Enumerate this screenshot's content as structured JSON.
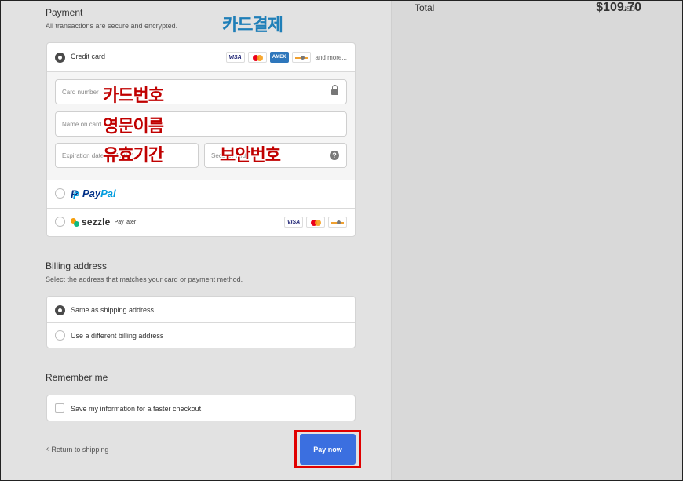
{
  "summary": {
    "total_label": "Total",
    "currency": "USD",
    "total_amount": "$109.70"
  },
  "payment": {
    "title": "Payment",
    "subtitle": "All transactions are secure and encrypted.",
    "credit_card_label": "Credit card",
    "credit_card_selected": true,
    "card_brands": [
      "VISA",
      "mastercard",
      "AMEX",
      "discover"
    ],
    "and_more": "and more...",
    "fields": {
      "card_number_placeholder": "Card number",
      "name_placeholder": "Name on card",
      "expiration_placeholder": "Expiration date (MM / YY)",
      "security_placeholder": "Security code"
    },
    "paypal": {
      "pay": "Pay",
      "pal": "Pal"
    },
    "sezzle": {
      "name": "sezzle",
      "tagline": "Pay later",
      "brands": [
        "VISA",
        "mastercard",
        "discover"
      ]
    }
  },
  "billing": {
    "title": "Billing address",
    "subtitle": "Select the address that matches your card or payment method.",
    "options": [
      {
        "label": "Same as shipping address",
        "selected": true
      },
      {
        "label": "Use a different billing address",
        "selected": false
      }
    ]
  },
  "remember": {
    "title": "Remember me",
    "checkbox_label": "Save my information for a faster checkout",
    "checked": false
  },
  "footer": {
    "return_label": "Return to shipping",
    "pay_label": "Pay now"
  },
  "annotations": {
    "card_payment": "카드결제",
    "card_number": "카드번호",
    "english_name": "영문이름",
    "expiration": "유효기간",
    "security_code": "보안번호"
  },
  "colors": {
    "accent_button": "#3b6fe0",
    "highlight_outline": "#e00000",
    "annotation_red": "#c00000",
    "annotation_blue": "#1f7fb8"
  }
}
